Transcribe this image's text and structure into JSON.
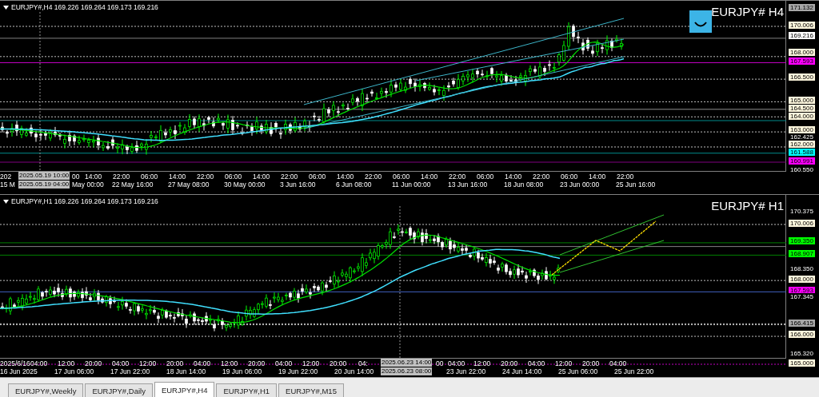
{
  "charts": [
    {
      "header": "EURJPY#,H4 169.226 169.264 169.173 169.216",
      "title": "EURJPY# H4",
      "price_labels": [
        {
          "text": "171.132",
          "kind": "boxed",
          "color": "#a8a8a8"
        },
        {
          "text": "170.006",
          "kind": "boxed",
          "color": "#fdf6dc"
        },
        {
          "text": "169.216",
          "kind": "boxed",
          "color": "#ffffff"
        },
        {
          "text": "168.000",
          "kind": "boxed",
          "color": "#fdf6dc"
        },
        {
          "text": "167.593",
          "kind": "boxed",
          "color": "#ff00ff"
        },
        {
          "text": "166.500",
          "kind": "boxed",
          "color": "#fdf6dc"
        },
        {
          "text": "165.000",
          "kind": "boxed",
          "color": "#fdf6dc"
        },
        {
          "text": "164.500",
          "kind": "boxed",
          "color": "#fdf6dc"
        },
        {
          "text": "164.000",
          "kind": "boxed",
          "color": "#fdf6dc"
        },
        {
          "text": "163.000",
          "kind": "boxed",
          "color": "#fdf6dc"
        },
        {
          "text": "162.425",
          "kind": "plain"
        },
        {
          "text": "162.000",
          "kind": "boxed",
          "color": "#fdf6dc"
        },
        {
          "text": "161.588",
          "kind": "boxed",
          "color": "#00ffff"
        },
        {
          "text": "160.991",
          "kind": "boxed",
          "color": "#ff00ff"
        },
        {
          "text": "160.550",
          "kind": "plain"
        }
      ],
      "time_upper": [
        "202",
        "00",
        "14:00",
        "22:00",
        "06:00",
        "14:00",
        "22:00",
        "06:00",
        "14:00",
        "22:00",
        "06:00",
        "14:00",
        "22:00",
        "06:00",
        "14:00",
        "22:00",
        "06:00",
        "14:00",
        "22:00",
        "06:00",
        "14:00",
        "22:00"
      ],
      "time_lower": [
        "15 M",
        "May 00:00",
        "22 May 16:00",
        "27 May 08:00",
        "30 May 00:00",
        "3 Jun 16:00",
        "6 Jun 08:00",
        "11 Jun 00:00",
        "13 Jun 16:00",
        "18 Jun 08:00",
        "23 Jun 00:00",
        "25 Jun 16:00"
      ],
      "crosshair_upper": "2025.05.19 10:00",
      "crosshair_lower": "2025.05.19 04:00"
    },
    {
      "header": "EURJPY#,H1 169.226 169.264 169.173 169.216",
      "title": "EURJPY# H1",
      "price_labels": [
        {
          "text": "170.375",
          "kind": "plain"
        },
        {
          "text": "170.006",
          "kind": "boxed",
          "color": "#fdf6dc"
        },
        {
          "text": "169.350",
          "kind": "boxed",
          "color": "#00ff00"
        },
        {
          "text": "168.907",
          "kind": "boxed",
          "color": "#00ff00"
        },
        {
          "text": "168.350",
          "kind": "plain"
        },
        {
          "text": "168.000",
          "kind": "boxed",
          "color": "#fdf6dc"
        },
        {
          "text": "167.593",
          "kind": "boxed",
          "color": "#ff00ff"
        },
        {
          "text": "167.345",
          "kind": "plain"
        },
        {
          "text": "166.415",
          "kind": "boxed",
          "color": "#a8a8a8"
        },
        {
          "text": "166.000",
          "kind": "boxed",
          "color": "#fdf6dc"
        },
        {
          "text": "165.320",
          "kind": "plain"
        },
        {
          "text": "165.000",
          "kind": "boxed",
          "color": "#fdf6dc"
        }
      ],
      "time_upper": [
        "2025/6/16",
        "04:00",
        "12:00",
        "20:00",
        "04:00",
        "12:00",
        "20:00",
        "04:00",
        "12:00",
        "20:00",
        "04:00",
        "12:00",
        "20:00",
        "04:",
        "00",
        "04:00",
        "12:00",
        "20:00",
        "04:00",
        "12:00",
        "20:00",
        "04:00"
      ],
      "time_lower": [
        "16 Jun 2025",
        "17 Jun 06:00",
        "17 Jun 22:00",
        "18 Jun 14:00",
        "19 Jun 06:00",
        "19 Jun 22:00",
        "20 Jun 14:00",
        "23 Jun 22:00",
        "24 Jun 14:00",
        "25 Jun 06:00",
        "25 Jun 22:00"
      ],
      "crosshair_upper": "2025.06.23 14:00",
      "crosshair_lower": "2025.06.23 08:00"
    }
  ],
  "tabs": [
    {
      "label": "EURJPY#,Weekly",
      "selected": false
    },
    {
      "label": "EURJPY#,Daily",
      "selected": false
    },
    {
      "label": "EURJPY#,H4",
      "selected": true
    },
    {
      "label": "EURJPY#,H1",
      "selected": false
    },
    {
      "label": "EURJPY#,M15",
      "selected": false
    }
  ]
}
